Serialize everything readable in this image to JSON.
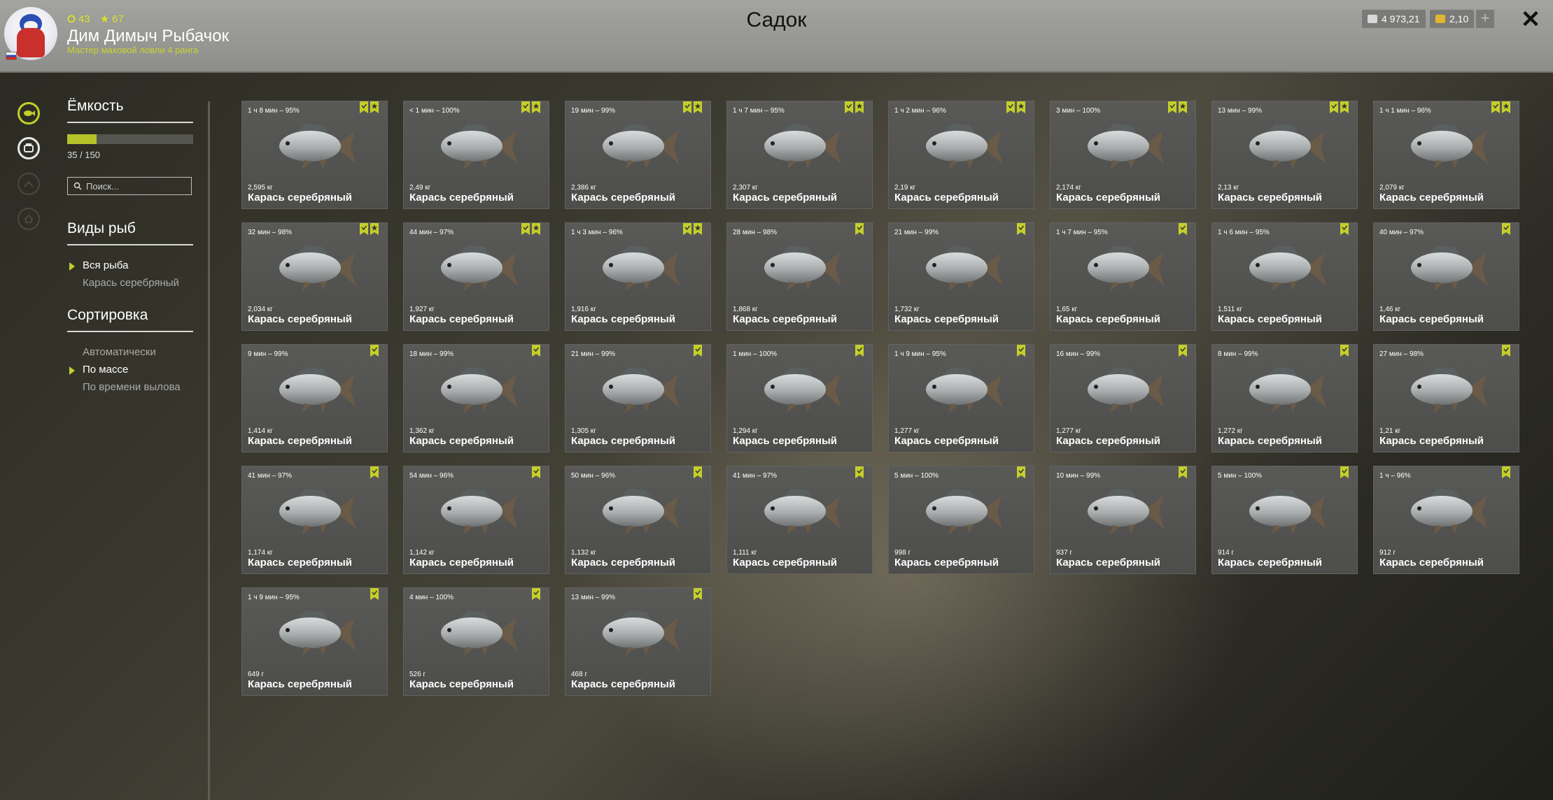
{
  "header": {
    "title": "Садок",
    "player": {
      "name": "Дим Димыч Рыбачок",
      "rank": "Мастер маховой ловли 4 ранга",
      "level": "43",
      "stars": "67"
    },
    "currency": {
      "silver": "4 973,21",
      "gold": "2,10"
    },
    "plus_label": "+",
    "close_label": "✕"
  },
  "sidebar": {
    "capacity": {
      "title": "Ёмкость",
      "current": 35,
      "max": 150,
      "text": "35 / 150"
    },
    "search": {
      "placeholder": "Поиск..."
    },
    "species": {
      "title": "Виды рыб",
      "items": [
        "Вся рыба",
        "Карась серебряный"
      ],
      "selected": 0
    },
    "sorting": {
      "title": "Сортировка",
      "items": [
        "Автоматически",
        "По массе",
        "По времени вылова"
      ],
      "selected": 1
    }
  },
  "colors": {
    "accent": "#c4cf2b",
    "card": "#545452"
  },
  "icons": [
    "fish-icon",
    "keepnet-icon",
    "rank-icon",
    "home-icon",
    "search-icon",
    "check-ribbon-icon",
    "star-ribbon-icon"
  ],
  "fish": [
    {
      "time": "1 ч 8 мин – 95%",
      "weight": "2,595 кг",
      "name": "Карась серебряный",
      "star": true
    },
    {
      "time": "< 1 мин – 100%",
      "weight": "2,49 кг",
      "name": "Карась серебряный",
      "star": true
    },
    {
      "time": "19 мин – 99%",
      "weight": "2,386 кг",
      "name": "Карась серебряный",
      "star": true
    },
    {
      "time": "1 ч 7 мин – 95%",
      "weight": "2,307 кг",
      "name": "Карась серебряный",
      "star": true
    },
    {
      "time": "1 ч 2 мин – 96%",
      "weight": "2,19 кг",
      "name": "Карась серебряный",
      "star": true
    },
    {
      "time": "3 мин – 100%",
      "weight": "2,174 кг",
      "name": "Карась серебряный",
      "star": true
    },
    {
      "time": "13 мин – 99%",
      "weight": "2,13 кг",
      "name": "Карась серебряный",
      "star": true
    },
    {
      "time": "1 ч 1 мин – 96%",
      "weight": "2,079 кг",
      "name": "Карась серебряный",
      "star": true
    },
    {
      "time": "32 мин – 98%",
      "weight": "2,034 кг",
      "name": "Карась серебряный",
      "star": true
    },
    {
      "time": "44 мин – 97%",
      "weight": "1,927 кг",
      "name": "Карась серебряный",
      "star": true
    },
    {
      "time": "1 ч 3 мин – 96%",
      "weight": "1,916 кг",
      "name": "Карась серебряный",
      "star": true
    },
    {
      "time": "28 мин – 98%",
      "weight": "1,868 кг",
      "name": "Карась серебряный",
      "star": false
    },
    {
      "time": "21 мин – 99%",
      "weight": "1,732 кг",
      "name": "Карась серебряный",
      "star": false
    },
    {
      "time": "1 ч 7 мин – 95%",
      "weight": "1,65 кг",
      "name": "Карась серебряный",
      "star": false
    },
    {
      "time": "1 ч 6 мин – 95%",
      "weight": "1,511 кг",
      "name": "Карась серебряный",
      "star": false
    },
    {
      "time": "40 мин – 97%",
      "weight": "1,46 кг",
      "name": "Карась серебряный",
      "star": false
    },
    {
      "time": "9 мин – 99%",
      "weight": "1,414 кг",
      "name": "Карась серебряный",
      "star": false
    },
    {
      "time": "18 мин – 99%",
      "weight": "1,362 кг",
      "name": "Карась серебряный",
      "star": false
    },
    {
      "time": "21 мин – 99%",
      "weight": "1,305 кг",
      "name": "Карась серебряный",
      "star": false
    },
    {
      "time": "1 мин – 100%",
      "weight": "1,294 кг",
      "name": "Карась серебряный",
      "star": false
    },
    {
      "time": "1 ч 9 мин – 95%",
      "weight": "1,277 кг",
      "name": "Карась серебряный",
      "star": false
    },
    {
      "time": "16 мин – 99%",
      "weight": "1,277 кг",
      "name": "Карась серебряный",
      "star": false
    },
    {
      "time": "8 мин – 99%",
      "weight": "1,272 кг",
      "name": "Карась серебряный",
      "star": false
    },
    {
      "time": "27 мин – 98%",
      "weight": "1,21 кг",
      "name": "Карась серебряный",
      "star": false
    },
    {
      "time": "41 мин – 97%",
      "weight": "1,174 кг",
      "name": "Карась серебряный",
      "star": false
    },
    {
      "time": "54 мин – 96%",
      "weight": "1,142 кг",
      "name": "Карась серебряный",
      "star": false
    },
    {
      "time": "50 мин – 96%",
      "weight": "1,132 кг",
      "name": "Карась серебряный",
      "star": false
    },
    {
      "time": "41 мин – 97%",
      "weight": "1,111 кг",
      "name": "Карась серебряный",
      "star": false
    },
    {
      "time": "5 мин – 100%",
      "weight": "998 г",
      "name": "Карась серебряный",
      "star": false
    },
    {
      "time": "10 мин – 99%",
      "weight": "937 г",
      "name": "Карась серебряный",
      "star": false
    },
    {
      "time": "5 мин – 100%",
      "weight": "914 г",
      "name": "Карась серебряный",
      "star": false
    },
    {
      "time": "1 ч – 96%",
      "weight": "912 г",
      "name": "Карась серебряный",
      "star": false
    },
    {
      "time": "1 ч 9 мин – 95%",
      "weight": "649 г",
      "name": "Карась серебряный",
      "star": false
    },
    {
      "time": "4 мин – 100%",
      "weight": "526 г",
      "name": "Карась серебряный",
      "star": false
    },
    {
      "time": "13 мин – 99%",
      "weight": "468 г",
      "name": "Карась серебряный",
      "star": false
    }
  ]
}
